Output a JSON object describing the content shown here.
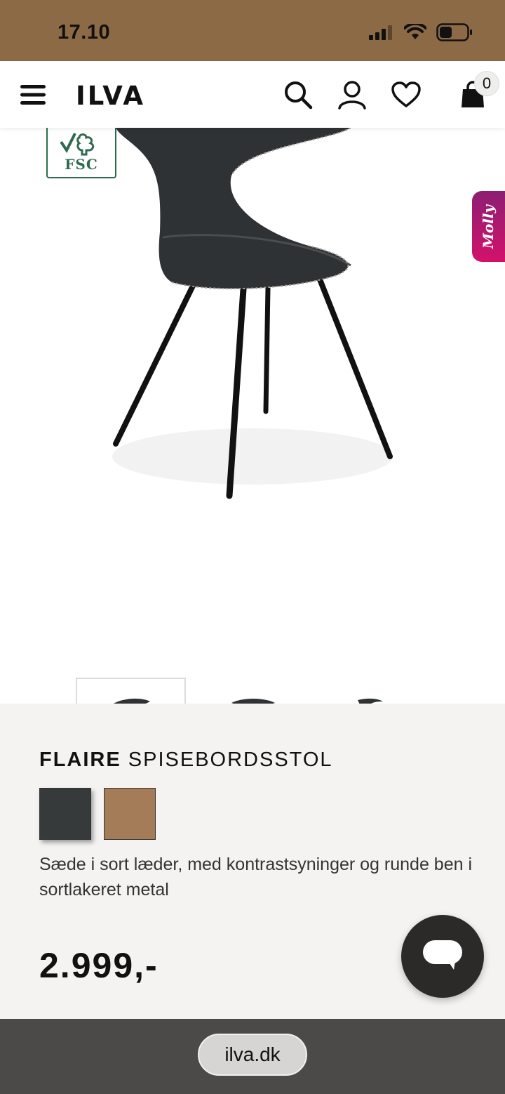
{
  "status_bar": {
    "time": "17.10"
  },
  "navbar": {
    "logo": "ILVA",
    "cart_count": "0"
  },
  "badges": {
    "fsc_label": "FSC",
    "molly_label": "Molly"
  },
  "gallery": {
    "thumbnails": [
      "front-view",
      "back-view",
      "side-view"
    ],
    "active_index": 0
  },
  "product": {
    "brand": "FLAIRE",
    "name": "SPISEBORDSSTOL",
    "swatches": [
      {
        "name": "black",
        "color": "#363a3b"
      },
      {
        "name": "cognac",
        "color": "#a57c58"
      }
    ],
    "description": "Sæde i sort læder, med kontrastsyninger og runde ben i sortlakeret metal",
    "price": "2.999,-"
  },
  "browser": {
    "url": "ilva.dk"
  },
  "colors": {
    "status_bar": "#8d6a46",
    "info_bg": "#f4f3f1",
    "molly_gradient_start": "#8b1f73",
    "molly_gradient_end": "#d4116a"
  }
}
